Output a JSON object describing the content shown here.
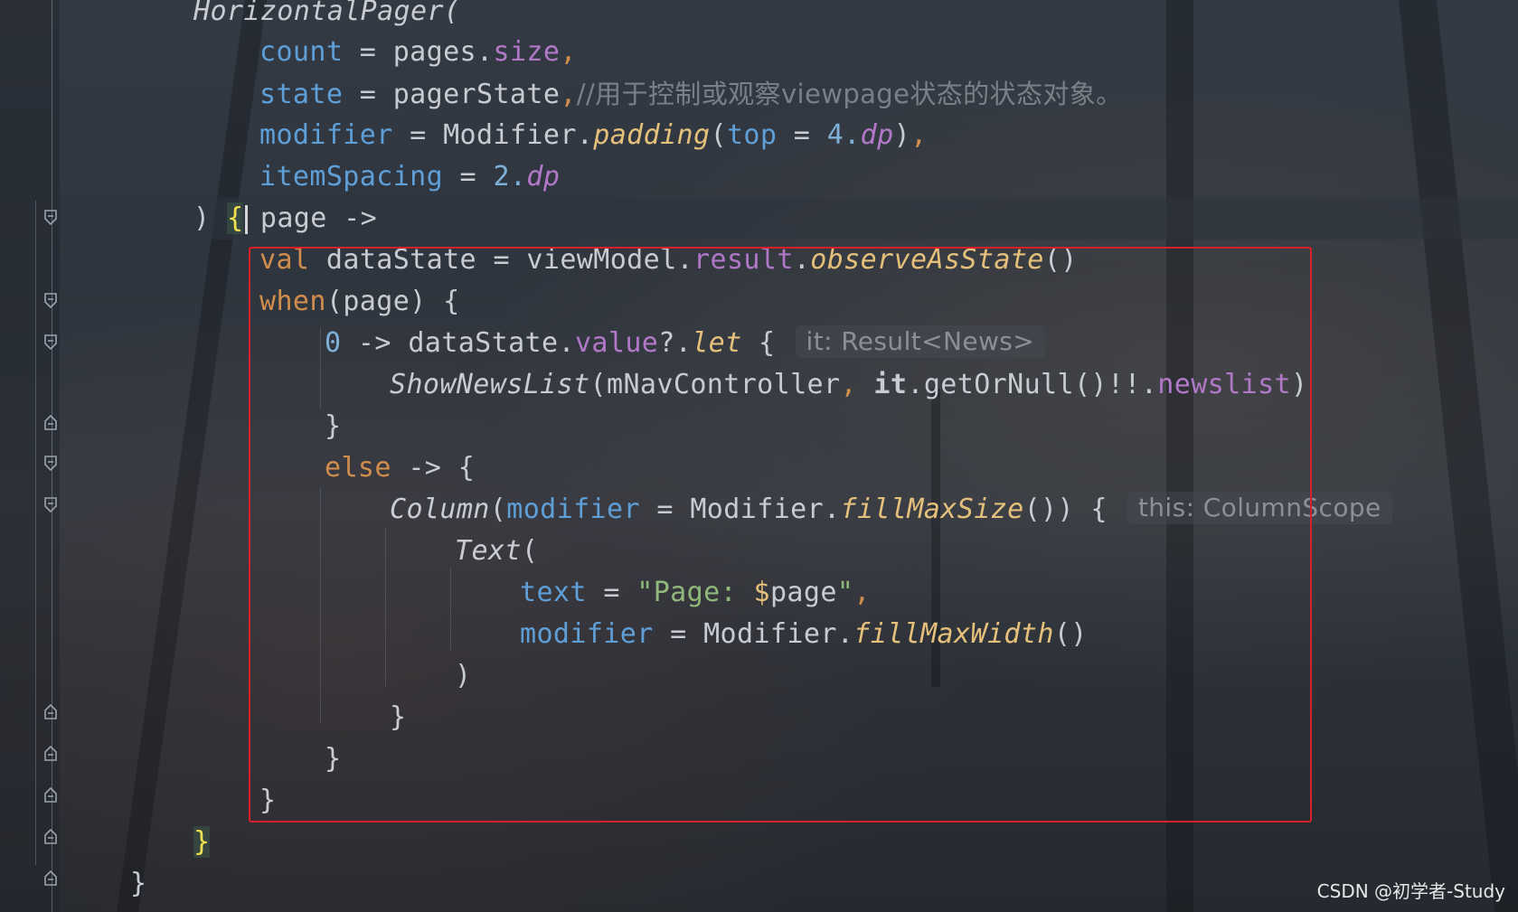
{
  "editor": {
    "lines": [
      {
        "tokens": [
          {
            "t": "HorizontalPager(",
            "c": "ital"
          }
        ]
      },
      {
        "tokens": [
          {
            "t": "count",
            "c": "param"
          },
          {
            "t": " = ",
            "c": "ident"
          },
          {
            "t": "pages.",
            "c": "ident"
          },
          {
            "t": "size",
            "c": "prop"
          },
          {
            "t": ",",
            "c": "kw"
          }
        ]
      },
      {
        "tokens": [
          {
            "t": "state",
            "c": "param"
          },
          {
            "t": " = ",
            "c": "ident"
          },
          {
            "t": "pagerState",
            "c": "ident"
          },
          {
            "t": ",",
            "c": "kw"
          },
          {
            "t": "//用于控制或观察viewpage状态的状态对象。",
            "c": "cmt"
          }
        ]
      },
      {
        "tokens": [
          {
            "t": "modifier",
            "c": "param"
          },
          {
            "t": " = ",
            "c": "ident"
          },
          {
            "t": "Modifier.",
            "c": "ident"
          },
          {
            "t": "padding",
            "c": "fn"
          },
          {
            "t": "(",
            "c": "ident"
          },
          {
            "t": "top",
            "c": "param"
          },
          {
            "t": " = ",
            "c": "ident"
          },
          {
            "t": "4.",
            "c": "num"
          },
          {
            "t": "dp",
            "c": "dp"
          },
          {
            "t": ")",
            "c": "ident"
          },
          {
            "t": ",",
            "c": "kw"
          }
        ]
      },
      {
        "tokens": [
          {
            "t": "itemSpacing",
            "c": "param"
          },
          {
            "t": " = ",
            "c": "ident"
          },
          {
            "t": "2.",
            "c": "num"
          },
          {
            "t": "dp",
            "c": "dp"
          }
        ]
      },
      {
        "tokens": [
          {
            "t": ") ",
            "c": "ident"
          },
          {
            "t": "{",
            "c": "brace-hl"
          },
          {
            "t": " page ->",
            "c": "ident"
          }
        ]
      },
      {
        "tokens": [
          {
            "t": "val ",
            "c": "kw"
          },
          {
            "t": "dataState = viewModel.",
            "c": "ident"
          },
          {
            "t": "result",
            "c": "prop"
          },
          {
            "t": ".",
            "c": "ident"
          },
          {
            "t": "observeAsState",
            "c": "fn"
          },
          {
            "t": "()",
            "c": "ident"
          }
        ]
      },
      {
        "tokens": [
          {
            "t": "when",
            "c": "kw"
          },
          {
            "t": "(page) {",
            "c": "ident"
          }
        ]
      },
      {
        "tokens": [
          {
            "t": "0",
            "c": "num"
          },
          {
            "t": " -> dataState.",
            "c": "ident"
          },
          {
            "t": "value",
            "c": "prop"
          },
          {
            "t": "?.",
            "c": "ident"
          },
          {
            "t": "let",
            "c": "fn"
          },
          {
            "t": " {",
            "c": "ident"
          }
        ],
        "hint": "it: Result<News>"
      },
      {
        "tokens": [
          {
            "t": "ShowNewsList",
            "c": "ital"
          },
          {
            "t": "(mNavController",
            "c": "ident"
          },
          {
            "t": ", ",
            "c": "kw"
          },
          {
            "t": "it",
            "c": "bold"
          },
          {
            "t": ".getOrNull()!!.",
            "c": "ident"
          },
          {
            "t": "newslist",
            "c": "prop"
          },
          {
            "t": ")",
            "c": "ident"
          }
        ]
      },
      {
        "tokens": [
          {
            "t": "}",
            "c": "ident"
          }
        ]
      },
      {
        "tokens": [
          {
            "t": "else",
            "c": "kw"
          },
          {
            "t": " -> {",
            "c": "ident"
          }
        ]
      },
      {
        "tokens": [
          {
            "t": "Column",
            "c": "ital"
          },
          {
            "t": "(",
            "c": "ident"
          },
          {
            "t": "modifier",
            "c": "param"
          },
          {
            "t": " = ",
            "c": "ident"
          },
          {
            "t": "Modifier.",
            "c": "ident"
          },
          {
            "t": "fillMaxSize",
            "c": "fn"
          },
          {
            "t": "()) {",
            "c": "ident"
          }
        ],
        "hint": "this: ColumnScope"
      },
      {
        "tokens": [
          {
            "t": "Text",
            "c": "ital"
          },
          {
            "t": "(",
            "c": "ident"
          }
        ]
      },
      {
        "tokens": [
          {
            "t": "text",
            "c": "param"
          },
          {
            "t": " = ",
            "c": "ident"
          },
          {
            "t": "\"Page: ",
            "c": "str"
          },
          {
            "t": "$",
            "c": "tmpl"
          },
          {
            "t": "page",
            "c": "ident"
          },
          {
            "t": "\"",
            "c": "str"
          },
          {
            "t": ",",
            "c": "kw"
          }
        ]
      },
      {
        "tokens": [
          {
            "t": "modifier",
            "c": "param"
          },
          {
            "t": " = ",
            "c": "ident"
          },
          {
            "t": "Modifier.",
            "c": "ident"
          },
          {
            "t": "fillMaxWidth",
            "c": "fn"
          },
          {
            "t": "()",
            "c": "ident"
          }
        ]
      },
      {
        "tokens": [
          {
            "t": ")",
            "c": "ident"
          }
        ]
      },
      {
        "tokens": [
          {
            "t": "}",
            "c": "ident"
          }
        ]
      },
      {
        "tokens": [
          {
            "t": "}",
            "c": "ident"
          }
        ]
      },
      {
        "tokens": [
          {
            "t": "}",
            "c": "ident"
          }
        ]
      },
      {
        "tokens": [
          {
            "t": "}",
            "c": "brace-hl"
          }
        ]
      },
      {
        "tokens": [
          {
            "t": "}",
            "c": "ident"
          }
        ]
      }
    ]
  },
  "gutter": {
    "fold_markers": [
      "fold-open",
      "fold-open",
      "fold-open",
      "fold-close",
      "fold-open",
      "fold-open",
      "fold-close",
      "fold-close",
      "fold-close",
      "fold-close",
      "fold-close"
    ]
  },
  "watermark": "CSDN @初学者-Study",
  "colors": {
    "highlight_box": "#d82028",
    "background": "#2b3038"
  }
}
